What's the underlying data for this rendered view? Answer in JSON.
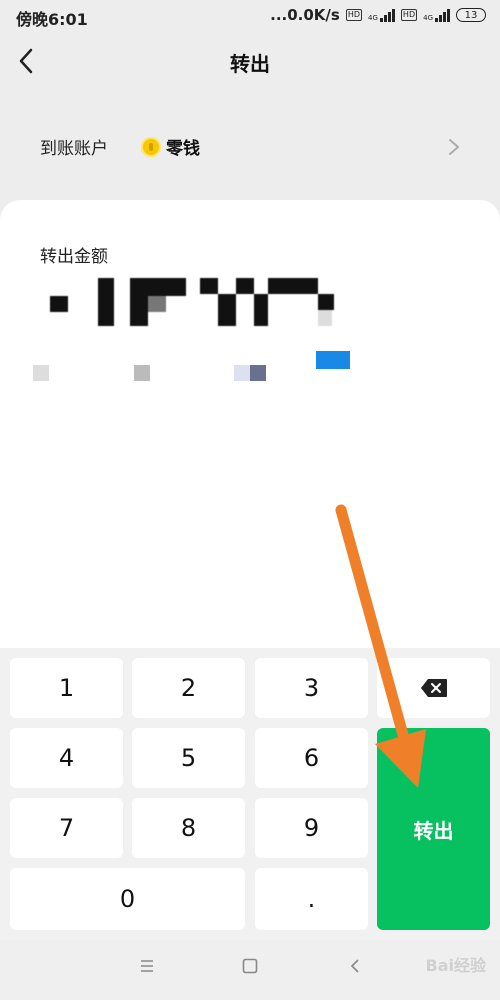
{
  "status_bar": {
    "time": "傍晚6:01",
    "net_speed": "...0.0K/s",
    "hd_badge": "HD",
    "net_type": "4G",
    "battery": "13"
  },
  "nav": {
    "title": "转出"
  },
  "account": {
    "label": "到账账户",
    "value": "零钱"
  },
  "amount": {
    "label": "转出金额"
  },
  "keypad": {
    "keys": [
      "1",
      "2",
      "3",
      "4",
      "5",
      "6",
      "7",
      "8",
      "9",
      "0",
      "."
    ],
    "confirm_label": "转出"
  },
  "watermark": "Bai经验",
  "colors": {
    "accent_green": "#07c160",
    "annotation_orange": "#f07f2a",
    "coin_yellow": "#f5c800"
  },
  "icons": {
    "back": "back-arrow-icon",
    "chevron": "chevron-right-icon",
    "delete": "backspace-icon",
    "coin": "coin-icon",
    "menu": "menu-icon",
    "home": "home-square-icon",
    "nav_back": "nav-back-icon"
  }
}
